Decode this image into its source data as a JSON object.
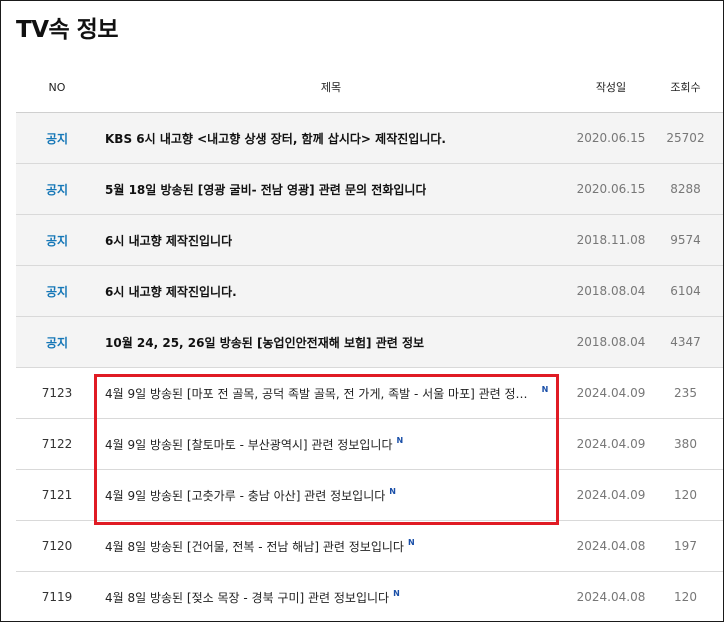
{
  "page": {
    "title": "TV속 정보"
  },
  "columns": {
    "no": "NO",
    "title": "제목",
    "date": "작성일",
    "views": "조회수"
  },
  "new_badge": "N",
  "rows": [
    {
      "no": "공지",
      "title": "KBS 6시 내고향 <내고향 상생 장터, 함께 삽시다> 제작진입니다.",
      "date": "2020.06.15",
      "views": "25702"
    },
    {
      "no": "공지",
      "title": "5월 18일 방송된 [영광 굴비- 전남 영광] 관련 문의 전화입니다",
      "date": "2020.06.15",
      "views": "8288"
    },
    {
      "no": "공지",
      "title": "6시 내고향 제작진입니다",
      "date": "2018.11.08",
      "views": "9574"
    },
    {
      "no": "공지",
      "title": "6시 내고향 제작진입니다.",
      "date": "2018.08.04",
      "views": "6104"
    },
    {
      "no": "공지",
      "title": "10월 24, 25, 26일 방송된 [농업인안전재해 보험] 관련 정보",
      "date": "2018.08.04",
      "views": "4347"
    },
    {
      "no": "7123",
      "title": "4월 9일 방송된 [마포 전 골목, 공덕 족발 골목, 전 가게, 족발 - 서울 마포] 관련 정…",
      "date": "2024.04.09",
      "views": "235"
    },
    {
      "no": "7122",
      "title": "4월 9일 방송된 [찰토마토 - 부산광역시] 관련 정보입니다",
      "date": "2024.04.09",
      "views": "380"
    },
    {
      "no": "7121",
      "title": "4월 9일 방송된 [고춧가루 - 충남 아산] 관련 정보입니다",
      "date": "2024.04.09",
      "views": "120"
    },
    {
      "no": "7120",
      "title": "4월 8일 방송된 [건어물, 전복 - 전남 해남] 관련 정보입니다",
      "date": "2024.04.08",
      "views": "197"
    },
    {
      "no": "7119",
      "title": "4월 8일 방송된 [젖소 목장 - 경북 구미] 관련 정보입니다",
      "date": "2024.04.08",
      "views": "120"
    }
  ],
  "colors": {
    "notice_label": "#1677b7",
    "new_badge": "#1a4fa8",
    "highlight_box": "#e01b24",
    "notice_row_bg": "#f4f4f4"
  }
}
